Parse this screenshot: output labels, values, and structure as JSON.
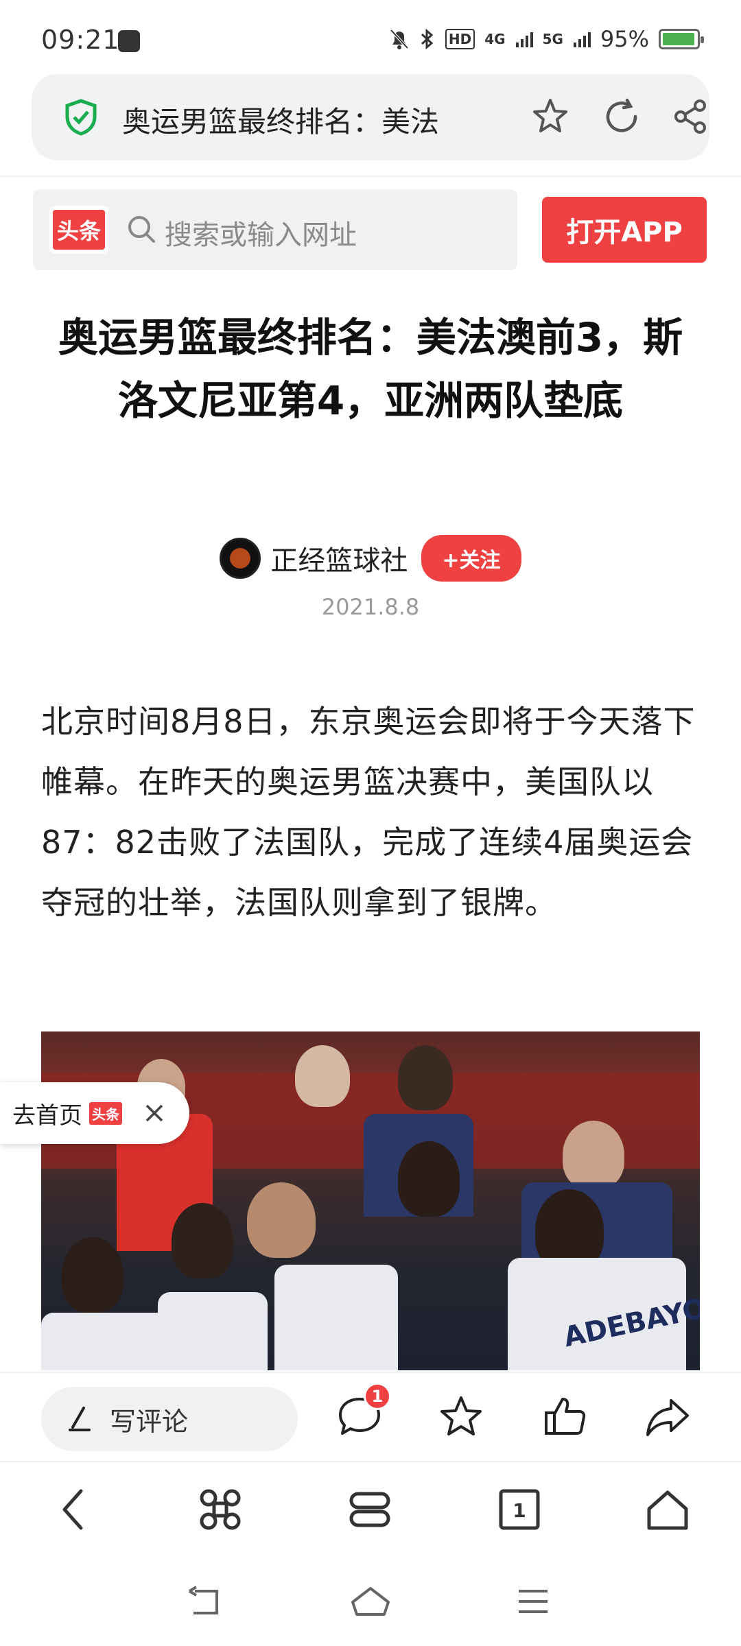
{
  "status_bar": {
    "time": "09:21",
    "network_hd": "HD",
    "network_4g": "4G",
    "network_5g": "5G",
    "battery_percent": "95%",
    "battery_level": 0.95
  },
  "address_bar": {
    "page_title": "奥运男篮最终排名：美法",
    "icons": [
      "shield-icon",
      "star-icon",
      "reload-icon",
      "share-icon"
    ]
  },
  "header": {
    "logo_text": "头条",
    "search_placeholder": "搜索或输入网址",
    "open_app_label": "打开APP"
  },
  "article": {
    "headline": "奥运男篮最终排名：美法澳前3，斯洛文尼亚第4，亚洲两队垫底",
    "author": "正经篮球社",
    "follow_label": "+关注",
    "date": "2021.8.8",
    "body": "北京时间8月8日，东京奥运会即将于今天落下帷幕。在昨天的奥运男篮决赛中，美国队以87：82击败了法国队，完成了连续4届奥运会夺冠的壮举，法国队则拿到了银牌。"
  },
  "floating": {
    "home_label": "去首页",
    "home_badge": "头条"
  },
  "comment_bar": {
    "write_comment_label": "写评论",
    "comment_count": "1"
  },
  "colors": {
    "accent": "#f04142",
    "secure_green": "#1aad4f"
  }
}
